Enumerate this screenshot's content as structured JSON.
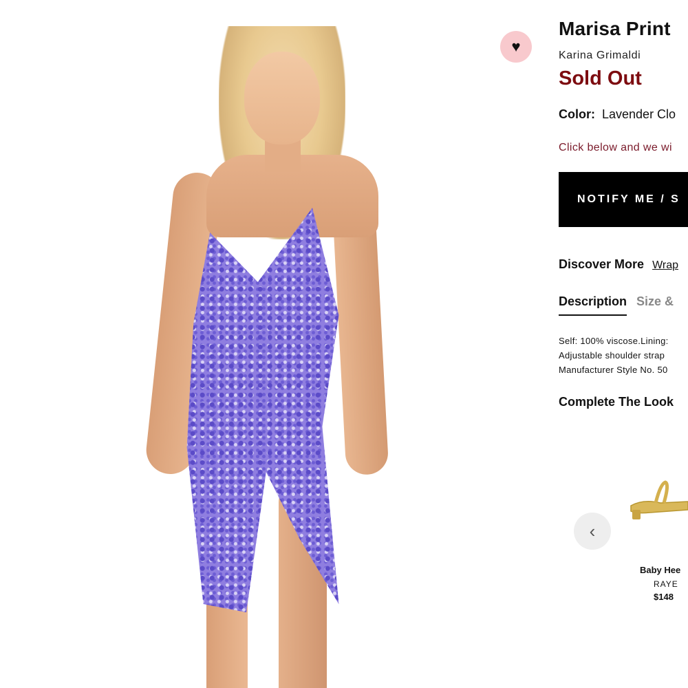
{
  "product": {
    "title": "Marisa Print",
    "brand": "Karina Grimaldi",
    "status": "Sold Out",
    "color_label": "Color:",
    "color_value": "Lavender Clo",
    "notice": "Click below and we wi",
    "notify_button": "NOTIFY ME / S",
    "discover_label": "Discover More",
    "discover_link": "Wrap",
    "tabs": [
      {
        "label": "Description",
        "active": true
      },
      {
        "label": "Size &",
        "active": false
      }
    ],
    "description_lines": [
      "Self: 100% viscose.Lining:",
      "Adjustable shoulder strap",
      "Manufacturer Style No. 50"
    ],
    "wishlist_icon": "heart-icon"
  },
  "complete_the_look": {
    "heading": "Complete The Look",
    "prev_icon": "chevron-left-icon",
    "items": [
      {
        "name": "Baby Hee",
        "brand": "RAYE",
        "price": "$148"
      }
    ]
  },
  "colors": {
    "sold_out": "#7d0c10",
    "notice": "#7a1a2a",
    "button_bg": "#000000",
    "wishlist_bg": "#f8c9cd",
    "dress": "#8f7ee0"
  }
}
